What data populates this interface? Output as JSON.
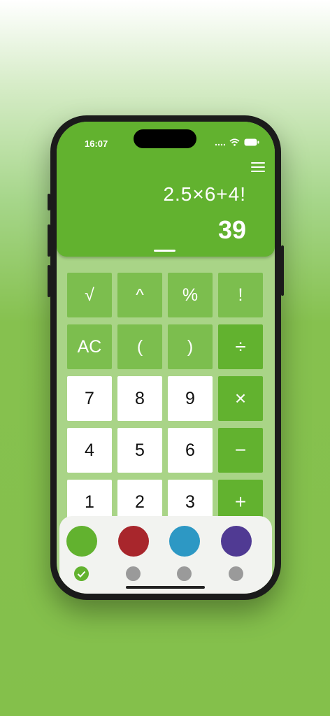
{
  "status_bar": {
    "time": "16:07"
  },
  "display": {
    "expression": "2.5×6+4!",
    "result": "39"
  },
  "keypad": {
    "rows": [
      [
        {
          "label": "√",
          "type": "fn"
        },
        {
          "label": "^",
          "type": "fn"
        },
        {
          "label": "%",
          "type": "fn"
        },
        {
          "label": "!",
          "type": "fn"
        }
      ],
      [
        {
          "label": "AC",
          "type": "fn"
        },
        {
          "label": "(",
          "type": "fn"
        },
        {
          "label": ")",
          "type": "fn"
        },
        {
          "label": "÷",
          "type": "op"
        }
      ],
      [
        {
          "label": "7",
          "type": "num"
        },
        {
          "label": "8",
          "type": "num"
        },
        {
          "label": "9",
          "type": "num"
        },
        {
          "label": "×",
          "type": "op"
        }
      ],
      [
        {
          "label": "4",
          "type": "num"
        },
        {
          "label": "5",
          "type": "num"
        },
        {
          "label": "6",
          "type": "num"
        },
        {
          "label": "−",
          "type": "op"
        }
      ],
      [
        {
          "label": "1",
          "type": "num"
        },
        {
          "label": "2",
          "type": "num"
        },
        {
          "label": "3",
          "type": "num"
        },
        {
          "label": "+",
          "type": "op"
        }
      ]
    ]
  },
  "themes": [
    {
      "color": "#62b22f",
      "selected": true
    },
    {
      "color": "#a8262c",
      "selected": false
    },
    {
      "color": "#2d98c4",
      "selected": false
    },
    {
      "color": "#503a93",
      "selected": false
    }
  ],
  "colors": {
    "accent": "#62b22f",
    "fn_key": "#7cbe4e",
    "unselected_marker": "#9a9a9a"
  }
}
